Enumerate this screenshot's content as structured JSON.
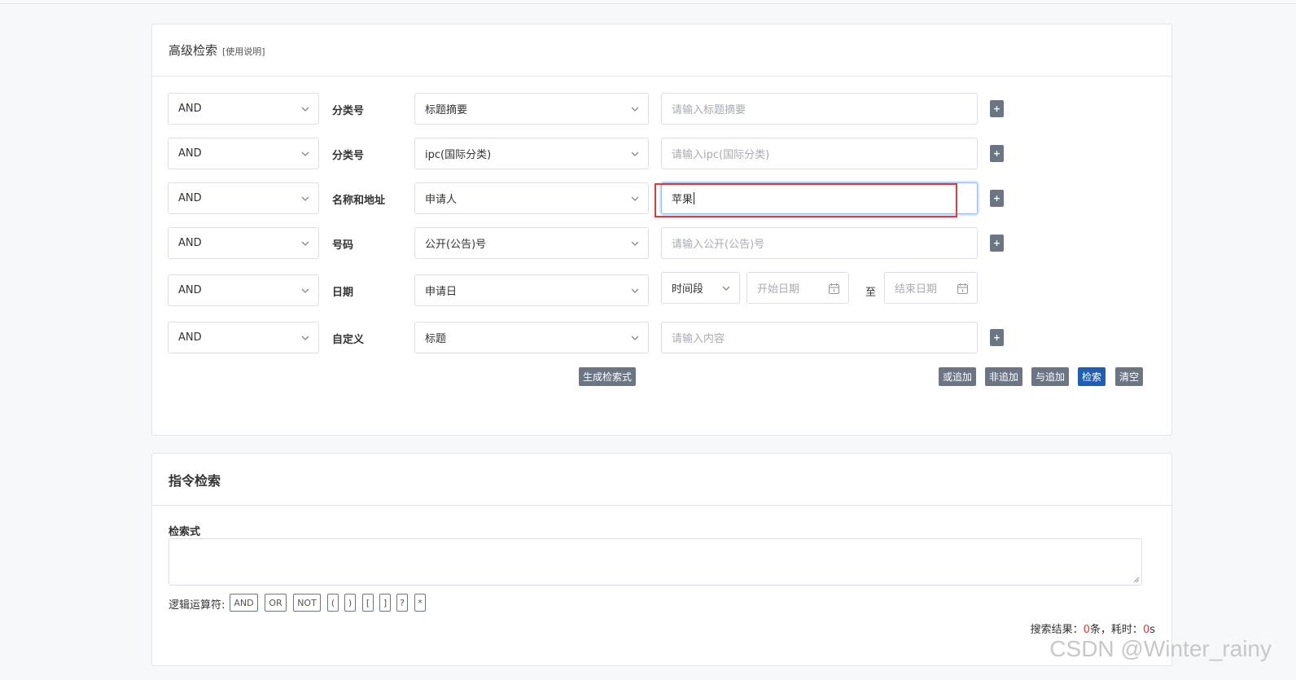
{
  "advanced": {
    "title": "高级检索",
    "help": "[使用说明]",
    "rows": [
      {
        "logic": "AND",
        "category": "分类号",
        "field": "标题摘要",
        "placeholder": "请输入标题摘要",
        "plus": "+"
      },
      {
        "logic": "AND",
        "category": "分类号",
        "field": "ipc(国际分类)",
        "placeholder": "请输入ipc(国际分类)",
        "plus": "+"
      },
      {
        "logic": "AND",
        "category": "名称和地址",
        "field": "申请人",
        "value": "苹果",
        "plus": "+"
      },
      {
        "logic": "AND",
        "category": "号码",
        "field": "公开(公告)号",
        "placeholder": "请输入公开(公告)号",
        "plus": "+"
      },
      {
        "logic": "AND",
        "category": "日期",
        "field": "申请日",
        "period": "时间段",
        "start_placeholder": "开始日期",
        "to": "至",
        "end_placeholder": "结束日期"
      },
      {
        "logic": "AND",
        "category": "自定义",
        "field": "标题",
        "placeholder": "请输入内容",
        "plus": "+"
      }
    ],
    "buttons": {
      "generate": "生成检索式",
      "or_add": "或追加",
      "not_add": "非追加",
      "and_add": "与追加",
      "search": "检索",
      "clear": "清空"
    }
  },
  "command": {
    "title": "指令检索",
    "expr_label": "检索式",
    "ops_label": "逻辑运算符:",
    "ops": [
      "AND",
      "OR",
      "NOT",
      "(",
      ")",
      "[",
      "]",
      "?",
      "*"
    ],
    "result_prefix": "搜索结果：",
    "result_count": "0",
    "result_mid": "条，耗时：",
    "result_time": "0",
    "result_unit": "s"
  },
  "watermark": "CSDN @Winter_rainy",
  "colors": {
    "primary": "#1e5fb4",
    "button_gray": "#6c7584",
    "highlight_red": "#e53935"
  }
}
